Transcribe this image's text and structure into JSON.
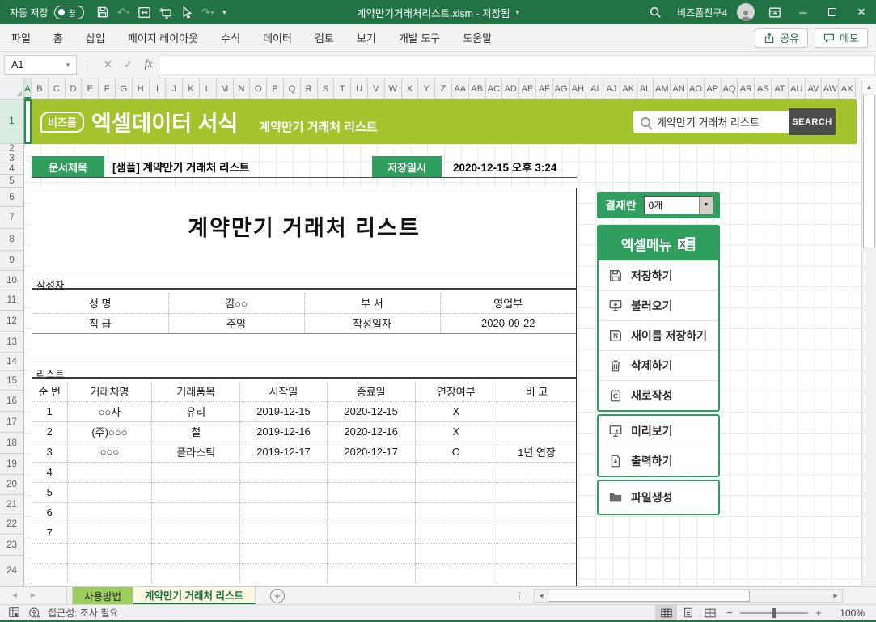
{
  "colors": {
    "theme_green": "#217346",
    "banner_green": "#a4c42d",
    "badge_green": "#2f9e5e",
    "search_button_gray": "#4d4d4d",
    "usage_tab_green": "#9ccd5e",
    "active_tab_cream": "#fdf8e2"
  },
  "titlebar": {
    "autosave_label": "자동 저장",
    "autosave_state": "끔",
    "title": "계약만기거래처리스트.xlsm - 저장됨",
    "user": "비즈폼친구4",
    "minimize": "─",
    "close": "✕"
  },
  "ribbon": {
    "tabs": [
      "파일",
      "홈",
      "삽입",
      "페이지 레이아웃",
      "수식",
      "데이터",
      "검토",
      "보기",
      "개발 도구",
      "도움말"
    ],
    "share_label": "공유",
    "comments_label": "메모"
  },
  "formula_bar": {
    "name_box": "A1",
    "cancel": "✕",
    "enter": "✓",
    "fx": "fx",
    "value": ""
  },
  "grid": {
    "columns": [
      "A",
      "B",
      "C",
      "D",
      "E",
      "F",
      "G",
      "H",
      "I",
      "J",
      "K",
      "L",
      "M",
      "N",
      "O",
      "P",
      "Q",
      "R",
      "S",
      "T",
      "U",
      "V",
      "W",
      "X",
      "Y",
      "Z",
      "AA",
      "AB",
      "AC",
      "AD",
      "AE",
      "AF",
      "AG",
      "AH",
      "AI",
      "AJ",
      "AK",
      "AL",
      "AM",
      "AN",
      "AO",
      "AP",
      "AQ",
      "AR",
      "AS",
      "AT",
      "AU",
      "AV",
      "AW",
      "AX"
    ],
    "rows": [
      "1",
      "2",
      "3",
      "4",
      "5",
      "6",
      "7",
      "8",
      "9",
      "10",
      "11",
      "12",
      "13",
      "14",
      "15",
      "16",
      "17",
      "18",
      "19",
      "20",
      "21",
      "22",
      "23",
      "24"
    ]
  },
  "banner": {
    "logo": "비즈폼",
    "title": "엑셀데이터 서식",
    "subtitle": "계약만기 거래처 리스트",
    "search_text": "계약만기 거래처 리스트",
    "search_button": "SEARCH"
  },
  "doc_header": {
    "title_label": "문서제목",
    "title_value": "[샘플] 계약만기 거래처 리스트",
    "saved_label": "저장일시",
    "saved_value": "2020-12-15  오후 3:24"
  },
  "document": {
    "main_title": "계약만기 거래처 리스트",
    "author_section_label": "작성자",
    "author_table": {
      "rows": [
        [
          {
            "label": "성  명",
            "value": "김○○"
          },
          {
            "label": "부  서",
            "value": "영업부"
          }
        ],
        [
          {
            "label": "직  급",
            "value": "주임"
          },
          {
            "label": "작성일자",
            "value": "2020-09-22"
          }
        ]
      ]
    },
    "list_section_label": "리스트",
    "list_table": {
      "headers": [
        "순 번",
        "거래처명",
        "거래품목",
        "시작일",
        "종료일",
        "연장여부",
        "비 고"
      ],
      "rows": [
        [
          "1",
          "○○사",
          "유리",
          "2019-12-15",
          "2020-12-15",
          "X",
          ""
        ],
        [
          "2",
          "(주)○○○",
          "철",
          "2019-12-16",
          "2020-12-16",
          "X",
          ""
        ],
        [
          "3",
          "○○○",
          "플라스틱",
          "2019-12-17",
          "2020-12-17",
          "O",
          "1년 연장"
        ],
        [
          "4",
          "",
          "",
          "",
          "",
          "",
          ""
        ],
        [
          "5",
          "",
          "",
          "",
          "",
          "",
          ""
        ],
        [
          "6",
          "",
          "",
          "",
          "",
          "",
          ""
        ],
        [
          "7",
          "",
          "",
          "",
          "",
          "",
          ""
        ],
        [
          "",
          "",
          "",
          "",
          "",
          "",
          ""
        ],
        [
          "",
          "",
          "",
          "",
          "",
          "",
          ""
        ]
      ]
    }
  },
  "sidebar": {
    "approval_label": "결재란",
    "approval_value": "0개",
    "menu_title": "엑셀메뉴",
    "menu_items": [
      {
        "icon": "save-icon",
        "label": "저장하기"
      },
      {
        "icon": "load-icon",
        "label": "불러오기"
      },
      {
        "icon": "save-as-icon",
        "label": "새이름 저장하기"
      },
      {
        "icon": "delete-icon",
        "label": "삭제하기"
      },
      {
        "icon": "new-doc-icon",
        "label": "새로작성"
      }
    ],
    "preview_items": [
      {
        "icon": "preview-icon",
        "label": "미리보기"
      },
      {
        "icon": "print-icon",
        "label": "출력하기"
      }
    ],
    "file_items": [
      {
        "icon": "folder-icon",
        "label": "파일생성"
      }
    ]
  },
  "sheet_tabs": {
    "tabs": [
      {
        "label": "사용방법",
        "active": false
      },
      {
        "label": "계약만기 거래처 리스트",
        "active": true
      }
    ]
  },
  "status_bar": {
    "accessibility": "접근성: 조사 필요",
    "zoom": "100%"
  }
}
